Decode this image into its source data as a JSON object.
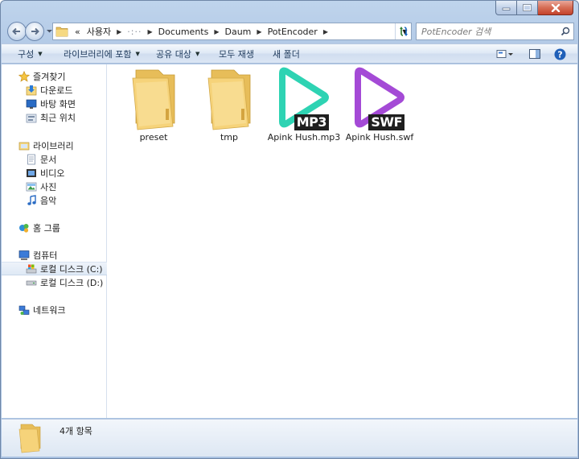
{
  "window": {
    "controls": {
      "minimize": "minimize",
      "maximize": "maximize",
      "close": "close"
    }
  },
  "address": {
    "crumbs": [
      {
        "label": "«"
      },
      {
        "label": "사용자"
      },
      {
        "label": "·:··"
      },
      {
        "label": "Documents"
      },
      {
        "label": "Daum"
      },
      {
        "label": "PotEncoder"
      }
    ]
  },
  "search": {
    "placeholder": "PotEncoder 검색"
  },
  "toolbar": {
    "organize": "구성",
    "include_library": "라이브러리에 포함",
    "share": "공유 대상",
    "burn": "모두 재생",
    "new_folder": "새 폴더"
  },
  "nav": {
    "favorites": "즐겨찾기",
    "downloads": "다운로드",
    "desktop": "바탕 화면",
    "recent": "최근 위치",
    "libraries": "라이브러리",
    "documents": "문서",
    "videos": "비디오",
    "pictures": "사진",
    "music": "음악",
    "homegroup": "홈 그룹",
    "computer": "컴퓨터",
    "drive_c": "로컬 디스크 (C:)",
    "drive_d": "로컬 디스크 (D:)",
    "network": "네트워크"
  },
  "files": [
    {
      "name": "preset",
      "type": "folder"
    },
    {
      "name": "tmp",
      "type": "folder"
    },
    {
      "name": "Apink Hush.mp3",
      "type": "media",
      "badge": "MP3",
      "color": "#2ed3b3"
    },
    {
      "name": "Apink Hush.swf",
      "type": "media",
      "badge": "SWF",
      "color": "#a44ad6"
    }
  ],
  "details": {
    "item_count": "4개 항목"
  },
  "colors": {
    "folder": "#f3d27a",
    "mp3": "#2ed3b3",
    "swf": "#a44ad6"
  }
}
